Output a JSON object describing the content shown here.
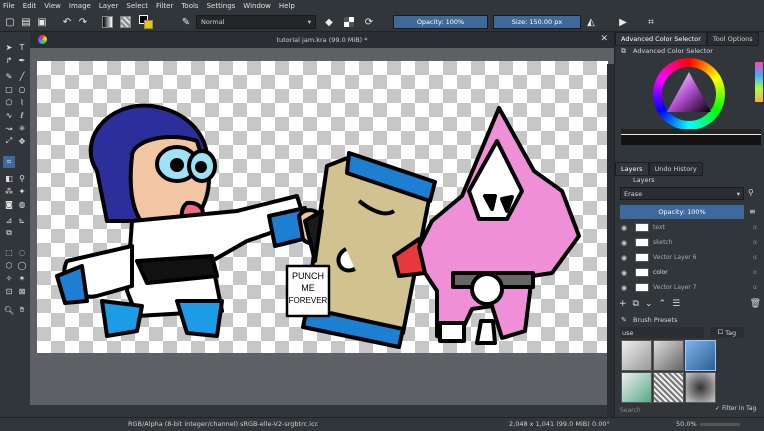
{
  "menu": [
    "File",
    "Edit",
    "View",
    "Image",
    "Layer",
    "Select",
    "Filter",
    "Tools",
    "Settings",
    "Window",
    "Help"
  ],
  "toolbar": {
    "brush_mode": "Normal",
    "opacity_label": "Opacity: 100%",
    "opacity_value": 100,
    "size_label": "Size: 150.00 px"
  },
  "document": {
    "title": "tutorial jam.kra (99.0 MiB) *"
  },
  "dock": {
    "color_tabs": [
      "Advanced Color Selector",
      "Tool Options"
    ],
    "color_panel_title": "Advanced Color Selector",
    "layer_tabs": [
      "Layers",
      "Undo History"
    ],
    "layers_title": "Layers",
    "blend_mode": "Erase",
    "layer_opacity_label": "Opacity:  100%",
    "layers": [
      {
        "name": "text"
      },
      {
        "name": "sketch"
      },
      {
        "name": "Vector Layer 6"
      },
      {
        "name": "color"
      },
      {
        "name": "Vector Layer 7"
      }
    ],
    "brush_presets_title": "Brush Presets",
    "brush_filter_value": "use",
    "tag_label": "Tag",
    "search_placeholder": "Search",
    "filter_in_tag_label": "Filter in Tag"
  },
  "canvas_text": {
    "sign_line1": "PUNCH",
    "sign_line2": "ME",
    "sign_line3": "FOREVER"
  },
  "status": {
    "color_profile": "RGB/Alpha (8-bit integer/channel)  sRGB-elle-V2-srgbtrc.icc",
    "dimensions": "2,048 x 1,041 (99.0 MiB)",
    "rotation": "0.00°",
    "zoom": "50.0%"
  },
  "colors": {
    "accent": "#3d6a9a",
    "window_bg": "#31363b",
    "canvas_bg": "#5d6165"
  }
}
